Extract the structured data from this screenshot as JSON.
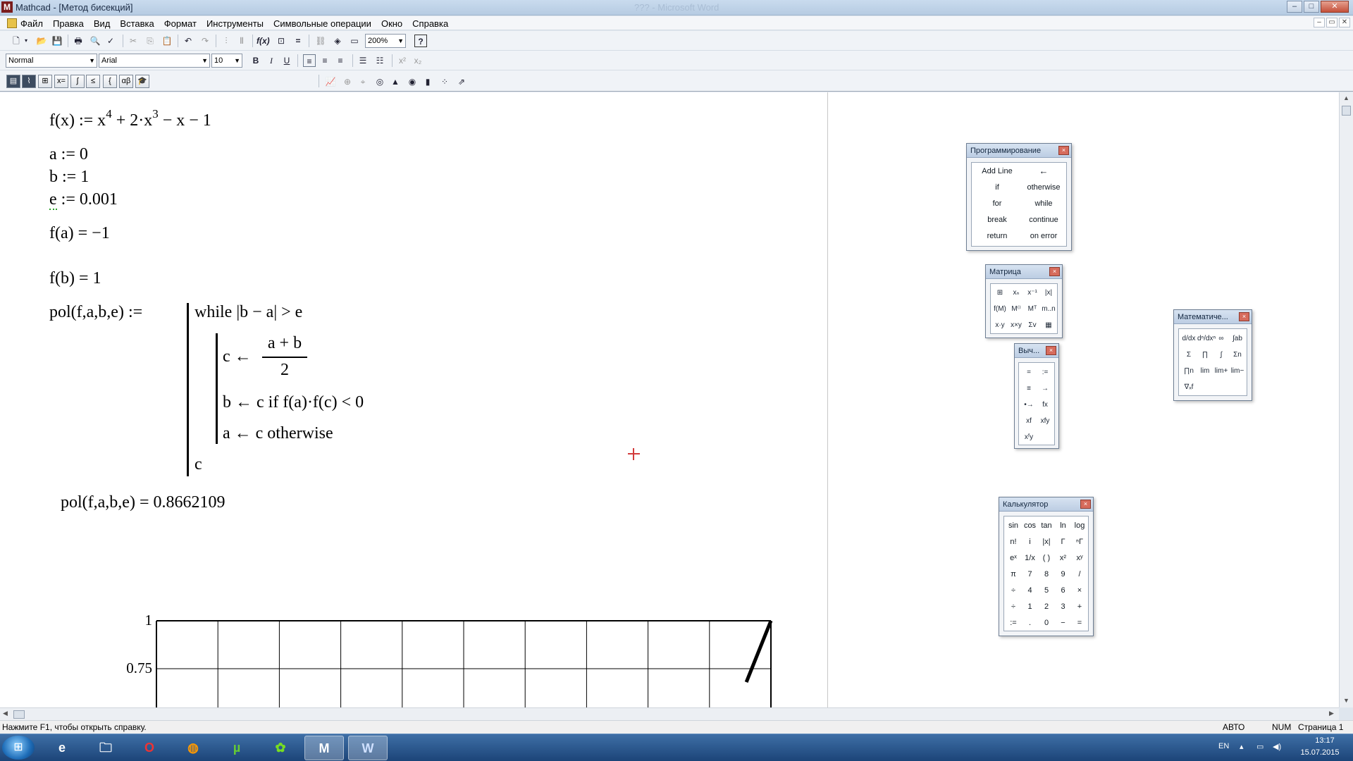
{
  "titlebar": {
    "app_title": "Mathcad - [Метод бисекций]",
    "ghost_title": "???  - Microsoft Word",
    "minimize": "–",
    "maximize": "□",
    "close": "✕"
  },
  "menubar": {
    "items": [
      "Файл",
      "Правка",
      "Вид",
      "Вставка",
      "Формат",
      "Инструменты",
      "Символьные операции",
      "Окно",
      "Справка"
    ],
    "mdi_minimize": "–",
    "mdi_restore": "▭",
    "mdi_close": "✕"
  },
  "toolbar": {
    "zoom_value": "200%",
    "help_label": "?"
  },
  "format_toolbar": {
    "style_value": "Normal",
    "font_value": "Arial",
    "size_value": "10",
    "bold": "B",
    "italic": "I",
    "underline": "U"
  },
  "worksheet": {
    "f_def_lhs": "f(x) := x",
    "f_def_exp1": "4",
    "f_def_mid": " + 2·x",
    "f_def_exp2": "3",
    "f_def_tail": " − x − 1",
    "a_def": "a := 0",
    "b_def": "b := 1",
    "e_var": "e",
    "e_def_rest": " := 0.001",
    "fa_eval": "f(a) = −1",
    "fb_eval": "f(b) = 1",
    "pol_def": "pol(f,a,b,e) :=",
    "while_line": "while  |b − a| > e",
    "c_assign": "c ←",
    "frac_num": "a + b",
    "frac_den": "2",
    "b_assign": "b ← c  if  f(a)·f(c) < 0",
    "a_assign": "a ← c  otherwise",
    "return_c": "c",
    "pol_eval": "pol(f,a,b,e) = 0.8662109"
  },
  "chart_data": {
    "type": "line",
    "title": "",
    "xlabel": "",
    "ylabel": "",
    "ytick_labels": [
      "1",
      "0.75"
    ],
    "ylim_visible": [
      0.75,
      1
    ],
    "x_gridlines": 10,
    "grid": true,
    "series": [
      {
        "x": [
          0.96,
          1.0
        ],
        "y": [
          0.68,
          1.0
        ]
      }
    ]
  },
  "palettes": {
    "programming": {
      "title": "Программирование",
      "items": [
        "Add Line",
        "←",
        "if",
        "otherwise",
        "for",
        "while",
        "break",
        "continue",
        "return",
        "on error"
      ]
    },
    "matrix": {
      "title": "Матрица",
      "icons": [
        "matrix-grid-icon",
        "subscript-icon",
        "inverse-icon",
        "determinant-icon",
        "vectorize-icon",
        "superscript-icon",
        "transpose-icon",
        "range-icon",
        "dot-product-icon",
        "cross-product-icon",
        "vector-sum-icon",
        "picture-icon"
      ],
      "glyphs": [
        "⊞",
        "xₙ",
        "x⁻¹",
        "|x|",
        "f(M)",
        "M⁽⁾",
        "Mᵀ",
        "m..n",
        "x·y",
        "x×y",
        "Σv",
        "▦"
      ]
    },
    "evaluation": {
      "title": "Выч...",
      "items": [
        "=",
        ":=",
        "≡",
        "→",
        "•→",
        "fx",
        "xf",
        "xfy",
        "xᶠy"
      ]
    },
    "calculus": {
      "title": "Математиче...",
      "glyphs": [
        "d/dx",
        "dⁿ/dxⁿ",
        "∞",
        "∫ab",
        "Σ",
        "∏",
        "∫",
        "Σn",
        "∏n",
        "lim",
        "lim+",
        "lim−",
        "∇ₓf"
      ]
    },
    "calculator": {
      "title": "Калькулятор",
      "rows": [
        [
          "sin",
          "cos",
          "tan",
          "ln",
          "log"
        ],
        [
          "n!",
          "i",
          "|x|",
          "Γ",
          "ⁿΓ"
        ],
        [
          "eˣ",
          "1/x",
          "( )",
          "x²",
          "xʸ"
        ],
        [
          "π",
          "7",
          "8",
          "9",
          "/"
        ],
        [
          "÷",
          "4",
          "5",
          "6",
          "×"
        ],
        [
          "÷",
          "1",
          "2",
          "3",
          "+"
        ],
        [
          ":=",
          ".",
          "0",
          "−",
          "="
        ]
      ]
    },
    "close_glyph": "×"
  },
  "statusbar": {
    "hint": "Нажмите F1, чтобы открыть справку.",
    "mode": "АВТО",
    "num": "NUM",
    "page": "Страница 1"
  },
  "taskbar": {
    "apps": [
      "start-orb-icon",
      "internet-explorer-icon",
      "file-explorer-icon",
      "opera-icon",
      "firefox-icon",
      "utorrent-icon",
      "icq-icon",
      "mathcad-icon",
      "word-icon"
    ],
    "lang": "EN",
    "time": "13:17",
    "date": "15.07.2015"
  }
}
